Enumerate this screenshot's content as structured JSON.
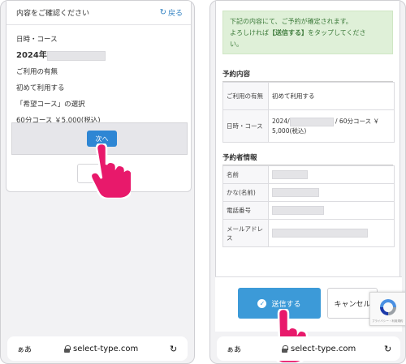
{
  "left": {
    "header": {
      "title": "内容をご確認ください",
      "back_label": "戻る"
    },
    "rows": [
      "日時・コース",
      "2024年",
      "ご利用の有無",
      "初めて利用する",
      "「希望コース」の選択",
      "60分コース ￥5,000(税込)"
    ],
    "next_label": "次へ",
    "url": {
      "aa": "ぁあ",
      "host": "select-type.com"
    }
  },
  "right": {
    "notice": {
      "line1": "下記の内容にて、ご予約が確定されます。",
      "line2a": "よろしければ",
      "line2b": "【送信する】",
      "line2c": "をタップしてくださ",
      "line3": "い。"
    },
    "reservation": {
      "title": "予約内容",
      "rows": [
        {
          "label": "ご利用の有無",
          "value": "初めて利用する"
        },
        {
          "label": "日時・コース",
          "value_a": "2024/",
          "value_b": "/ 60分コース ￥",
          "value_c": "5,000(税込)"
        }
      ]
    },
    "reserver": {
      "title": "予約者情報",
      "labels": [
        "名前",
        "かな(名前)",
        "電話番号",
        "メールアドレス"
      ]
    },
    "submit_label": "送信する",
    "cancel_label": "キャンセル",
    "recaptcha_note": "プライバシー・利用規約",
    "url": {
      "aa": "ぁあ",
      "host": "select-type.com"
    }
  },
  "colors": {
    "accent": "#2e86d4",
    "notice_bg": "#dff0d8",
    "hand": "#e8196b"
  }
}
